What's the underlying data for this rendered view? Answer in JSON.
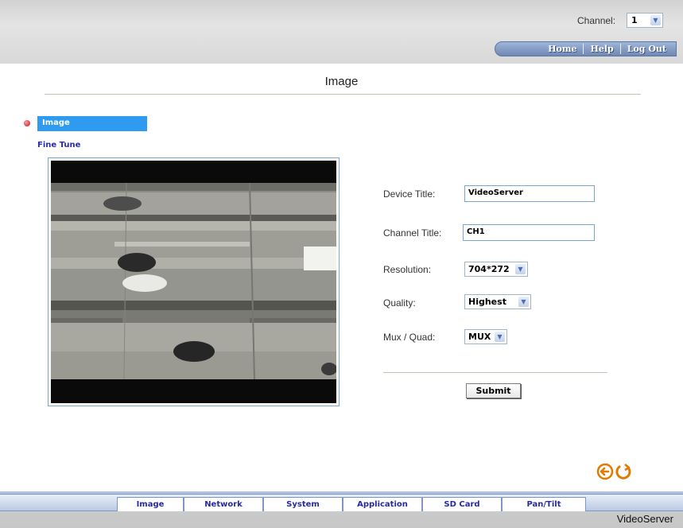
{
  "header": {
    "channel_label": "Channel:",
    "channel_value": "1",
    "nav": {
      "home": "Home",
      "help": "Help",
      "logout": "Log Out"
    }
  },
  "page": {
    "title": "Image"
  },
  "sidebar": {
    "items": [
      {
        "label": "Image",
        "active": true
      },
      {
        "label": "Fine Tune",
        "active": false
      }
    ]
  },
  "form": {
    "device_title_label": "Device Title:",
    "device_title_value": "VideoServer",
    "channel_title_label": "Channel Title:",
    "channel_title_value": "CH1",
    "resolution_label": "Resolution:",
    "resolution_value": "704*272",
    "quality_label": "Quality:",
    "quality_value": "Highest",
    "mux_label": "Mux / Quad:",
    "mux_value": "MUX",
    "submit_label": "Submit"
  },
  "footer": {
    "tabs": [
      "Image",
      "Network",
      "System",
      "Application",
      "SD Card",
      "Pan/Tilt"
    ],
    "brand": "VideoServer"
  },
  "colors": {
    "active_menu": "#2e9bf0",
    "nav_tab": "#6f88b5",
    "link": "#2a2ab0",
    "icon_orange": "#e07a00"
  }
}
